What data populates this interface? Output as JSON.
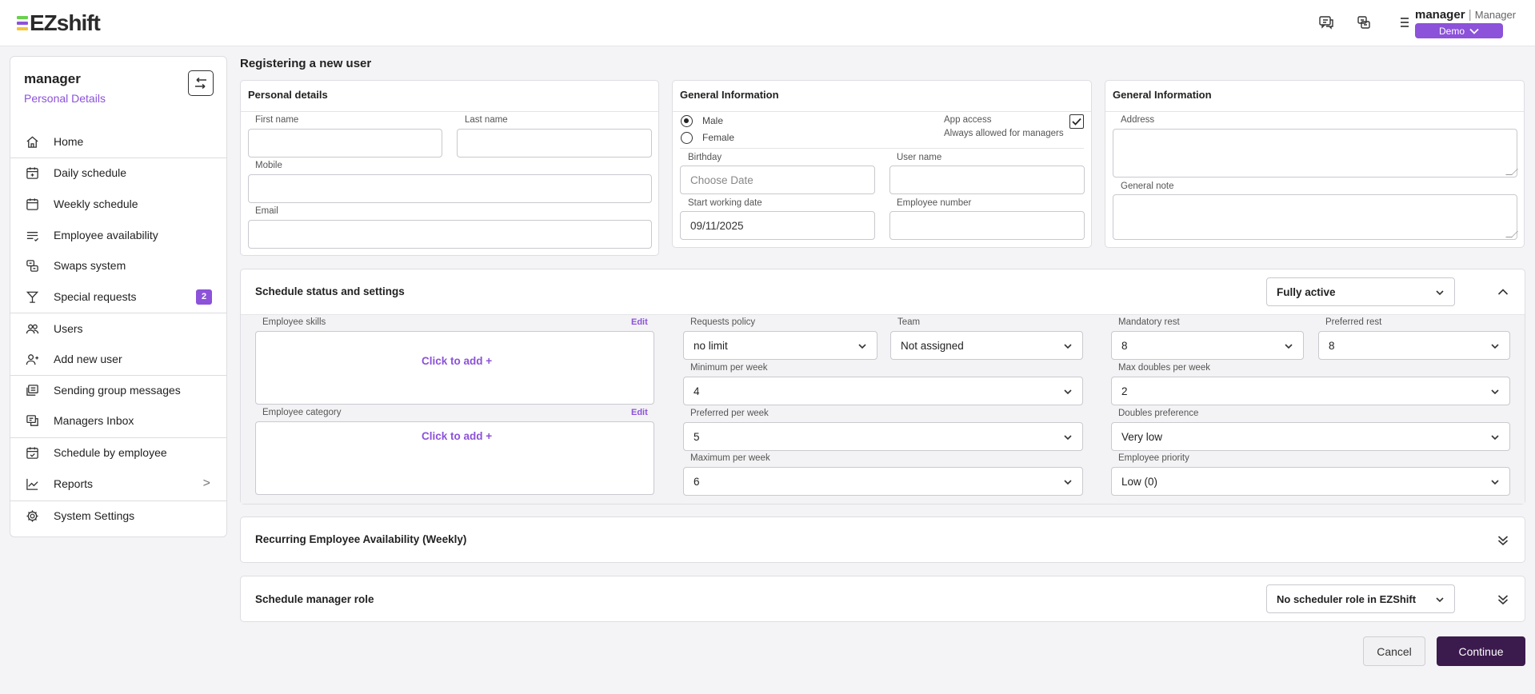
{
  "app": {
    "logo_text": "EZshift",
    "logo_colors": [
      "#6ad04e",
      "#8c52d9",
      "#f4c43a"
    ],
    "accent": "#8c52d9",
    "primary_dark": "#3b1a4d"
  },
  "header": {
    "user_name": "manager",
    "separator": "|",
    "user_role": "Manager",
    "org_button": "Demo",
    "icons": [
      "chat-icon",
      "swap-icon",
      "menu-icon",
      "chevron-down-icon"
    ]
  },
  "sidebar": {
    "user_name": "manager",
    "subtitle": "Personal Details",
    "items": [
      {
        "label": "Home",
        "icon": "home-icon"
      },
      {
        "label": "Daily schedule",
        "icon": "calendar-day-icon"
      },
      {
        "label": "Weekly schedule",
        "icon": "calendar-week-icon"
      },
      {
        "label": "Employee availability",
        "icon": "availability-list-icon"
      },
      {
        "label": "Swaps system",
        "icon": "swap-icon"
      },
      {
        "label": "Special requests",
        "icon": "cocktail-icon",
        "badge": "2"
      },
      {
        "label": "Users",
        "icon": "users-icon"
      },
      {
        "label": "Add new user",
        "icon": "user-plus-icon"
      },
      {
        "label": "Sending group messages",
        "icon": "messages-icon"
      },
      {
        "label": "Managers Inbox",
        "icon": "inbox-icon"
      },
      {
        "label": "Schedule by employee",
        "icon": "calendar-check-icon"
      },
      {
        "label": "Reports",
        "icon": "chart-icon",
        "chevron": ">"
      },
      {
        "label": "System Settings",
        "icon": "gear-icon"
      }
    ]
  },
  "page": {
    "title": "Registering a new user"
  },
  "personal": {
    "title": "Personal details",
    "first_name_label": "First name",
    "first_name_value": "",
    "last_name_label": "Last name",
    "last_name_value": "",
    "mobile_label": "Mobile",
    "mobile_value": "",
    "email_label": "Email",
    "email_value": ""
  },
  "general": {
    "title": "General Information",
    "male_label": "Male",
    "female_label": "Female",
    "gender_selected": "Male",
    "app_access_label": "App access",
    "app_access_note": "Always allowed for managers",
    "app_access_checked": true,
    "birthday_label": "Birthday",
    "birthday_placeholder": "Choose Date",
    "username_label": "User name",
    "username_value": "",
    "start_date_label": "Start working date",
    "start_date_value": "09/11/2025",
    "employee_number_label": "Employee number",
    "employee_number_value": ""
  },
  "general2": {
    "title": "General Information",
    "address_label": "Address",
    "address_value": "",
    "note_label": "General note",
    "note_value": ""
  },
  "schedule_settings": {
    "title": "Schedule status and settings",
    "status_value": "Fully active",
    "skills_label": "Employee skills",
    "skills_edit": "Edit",
    "skills_add": "Click to add +",
    "category_label": "Employee category",
    "category_edit": "Edit",
    "category_add": "Click to add +",
    "requests_policy_label": "Requests policy",
    "requests_policy_value": "no limit",
    "team_label": "Team",
    "team_value": "Not assigned",
    "min_week_label": "Minimum per week",
    "min_week_value": "4",
    "pref_week_label": "Preferred per week",
    "pref_week_value": "5",
    "max_week_label": "Maximum per week",
    "max_week_value": "6",
    "mandatory_rest_label": "Mandatory rest",
    "mandatory_rest_value": "8",
    "preferred_rest_label": "Preferred rest",
    "preferred_rest_value": "8",
    "max_doubles_label": "Max doubles per week",
    "max_doubles_value": "2",
    "doubles_pref_label": "Doubles preference",
    "doubles_pref_value": "Very low",
    "priority_label": "Employee priority",
    "priority_value": "Low (0)"
  },
  "recurring": {
    "title": "Recurring Employee Availability (Weekly)"
  },
  "manager_role": {
    "title": "Schedule manager role",
    "value": "No scheduler role in EZShift"
  },
  "actions": {
    "cancel": "Cancel",
    "continue": "Continue"
  }
}
